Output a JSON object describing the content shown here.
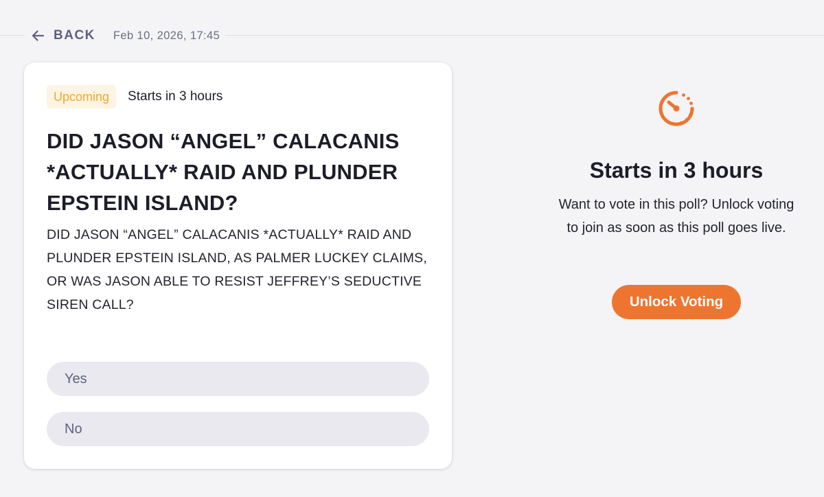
{
  "header": {
    "back_label": "BACK",
    "timestamp": "Feb 10, 2026, 17:45"
  },
  "poll": {
    "status_badge": "Upcoming",
    "status_text": "Starts in 3 hours",
    "title": "DID JASON “ANGEL” CALACANIS *ACTUALLY* RAID AND PLUNDER EPSTEIN ISLAND?",
    "description": "DID JASON “ANGEL” CALACANIS *ACTUALLY* RAID AND PLUNDER EPSTEIN ISLAND, AS PALMER LUCKEY CLAIMS, OR WAS JASON ABLE TO RESIST JEFFREY’S SEDUCTIVE SIREN CALL?",
    "options": [
      {
        "label": "Yes"
      },
      {
        "label": "No"
      }
    ]
  },
  "side_panel": {
    "icon": "timer-icon",
    "title": "Starts in 3 hours",
    "description": "Want to vote in this poll? Unlock voting to join as soon as this poll goes live.",
    "button_label": "Unlock Voting"
  },
  "colors": {
    "background": "#f4f4f6",
    "accent": "#ee7530",
    "badge_text": "#f0a930",
    "badge_bg": "#fdf4e2",
    "muted_text": "#5d5f82",
    "option_bg": "#e9e9ef"
  }
}
